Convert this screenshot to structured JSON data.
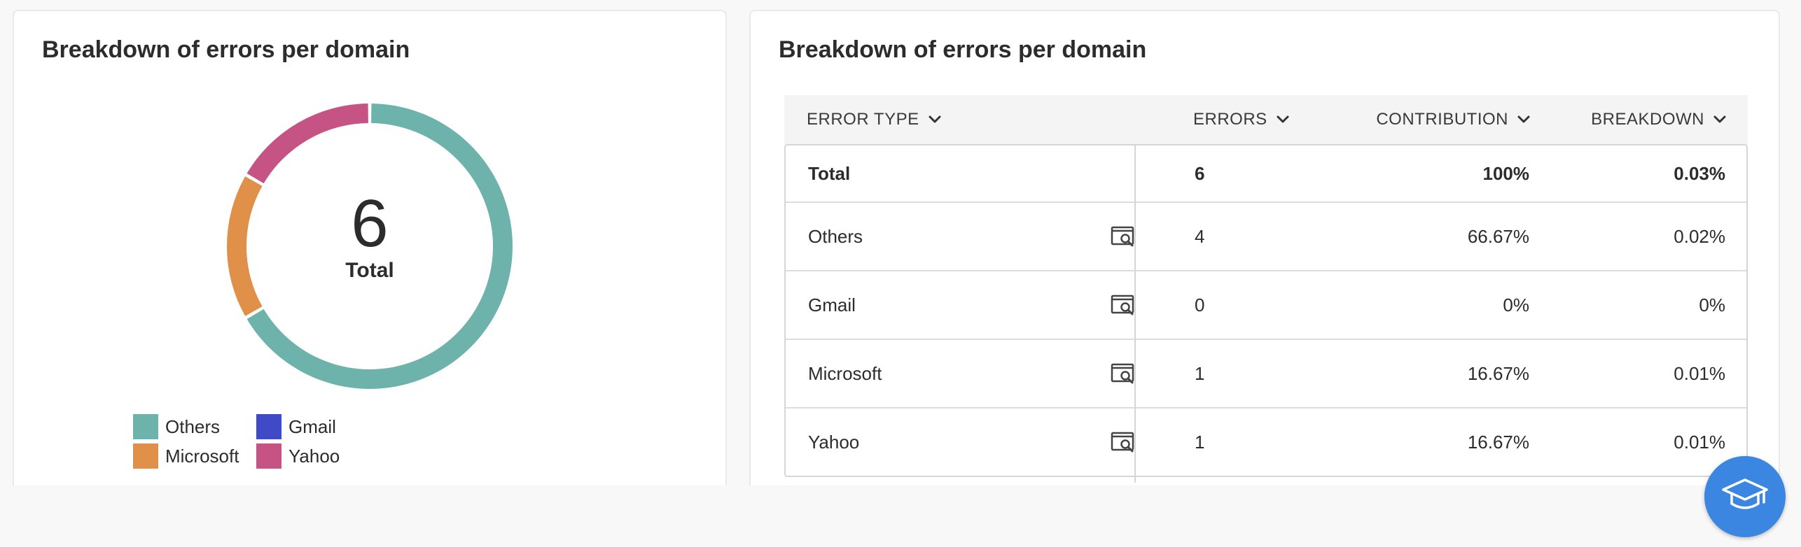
{
  "left_panel": {
    "title": "Breakdown of errors per domain",
    "total_value": "6",
    "total_label": "Total",
    "legend": [
      {
        "label": "Others",
        "color": "#6db3ac"
      },
      {
        "label": "Gmail",
        "color": "#4049c8"
      },
      {
        "label": "Microsoft",
        "color": "#e09049"
      },
      {
        "label": "Yahoo",
        "color": "#c55485"
      }
    ]
  },
  "chart_data": {
    "type": "pie",
    "donut": true,
    "center_text": "6",
    "center_label": "Total",
    "categories": [
      "Others",
      "Gmail",
      "Microsoft",
      "Yahoo"
    ],
    "values": [
      4,
      0,
      1,
      1
    ],
    "colors": [
      "#6db3ac",
      "#4049c8",
      "#e09049",
      "#c55485"
    ],
    "legend_position": "bottom-left"
  },
  "right_panel": {
    "title": "Breakdown of errors per domain",
    "columns": [
      "ERROR TYPE",
      "ERRORS",
      "CONTRIBUTION",
      "BREAKDOWN"
    ],
    "rows": [
      {
        "name": "Total",
        "errors": "6",
        "contribution": "100%",
        "breakdown": "0.03%"
      },
      {
        "name": "Others",
        "errors": "4",
        "contribution": "66.67%",
        "breakdown": "0.02%"
      },
      {
        "name": "Gmail",
        "errors": "0",
        "contribution": "0%",
        "breakdown": "0%"
      },
      {
        "name": "Microsoft",
        "errors": "1",
        "contribution": "16.67%",
        "breakdown": "0.01%"
      },
      {
        "name": "Yahoo",
        "errors": "1",
        "contribution": "16.67%",
        "breakdown": "0.01%"
      }
    ]
  },
  "help_button": {
    "icon": "graduation-cap-icon",
    "color": "#3a86e0"
  }
}
